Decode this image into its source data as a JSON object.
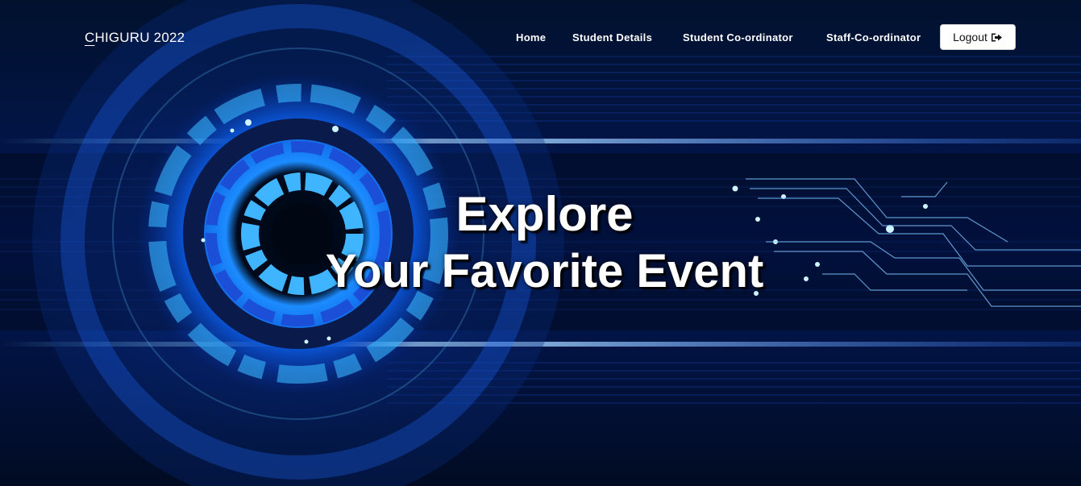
{
  "brand": {
    "first_letter": "C",
    "rest": "HIGURU 2022"
  },
  "nav": {
    "items": [
      {
        "label": "Home"
      },
      {
        "label": "Student Details"
      },
      {
        "label": "Student Co-ordinator"
      },
      {
        "label": "Staff-Co-ordinator"
      }
    ],
    "logout_label": "Logout"
  },
  "hero": {
    "title": "Explore",
    "subtitle": "Your Favorite Event"
  },
  "colors": {
    "background": "#010a1e",
    "accent_blue": "#1e7bff",
    "glow_cyan": "#5fd8ff"
  },
  "icons": {
    "logout": "sign-out-icon"
  }
}
